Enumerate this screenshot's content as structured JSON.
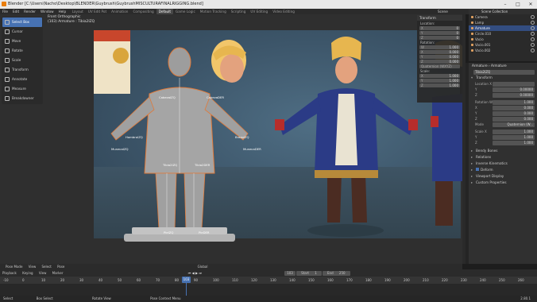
{
  "window": {
    "title": "Blender [C:\\Users\\Nacho\\Desktop\\BLENDER\\Guybrush\\GuybrushMISCULTURAFINALRIGGING.blend]"
  },
  "menu": {
    "items": [
      "File",
      "Edit",
      "Render",
      "Window",
      "Help"
    ],
    "workspaces": [
      "Layout",
      "UV Edit Pot",
      "Animation",
      "Compositing",
      "Default",
      "Game Logic",
      "Motion Tracking",
      "Scripting",
      "UV Editing",
      "Video Editing"
    ],
    "active_workspace": "Default",
    "scene": "Scene",
    "render_layer": "RenderLayer"
  },
  "viewport": {
    "view_name": "Front Orthographic",
    "object_info": "(103) Armature : Tibia2IZQ",
    "mode": "Pose Mode",
    "header_menus": [
      "View",
      "Select",
      "Pose"
    ],
    "orientation": "Global"
  },
  "tools": [
    {
      "label": "Select Box",
      "icon": "select-box-icon",
      "active": true
    },
    {
      "label": "Cursor",
      "icon": "cursor-icon",
      "active": false
    },
    {
      "label": "Move",
      "icon": "move-icon",
      "active": false
    },
    {
      "label": "Rotate",
      "icon": "rotate-icon",
      "active": false
    },
    {
      "label": "Scale",
      "icon": "scale-icon",
      "active": false
    },
    {
      "label": "Transform",
      "icon": "transform-icon",
      "active": false
    },
    {
      "label": "Annotate",
      "icon": "annotate-icon",
      "active": false
    },
    {
      "label": "Measure",
      "icon": "measure-icon",
      "active": false
    },
    {
      "label": "Breakdowner",
      "icon": "breakdowner-icon",
      "active": false
    }
  ],
  "bone_labels": [
    "CabezaIZQ",
    "CabezaDER",
    "HombroIZQ",
    "BrazoIZQ",
    "Tibia2IZQ",
    "Tibia2DER",
    "MunecaIZQ",
    "MunecaDER",
    "PieIZQ",
    "PieDER"
  ],
  "npanel": {
    "title": "Transform",
    "location_label": "Location:",
    "location": [
      {
        "k": "X",
        "v": "0"
      },
      {
        "k": "Y",
        "v": "0"
      },
      {
        "k": "Z",
        "v": "0"
      }
    ],
    "rotation_label": "Rotation:",
    "rotation": [
      {
        "k": "W",
        "v": "1.000"
      },
      {
        "k": "X",
        "v": "0.000"
      },
      {
        "k": "Y",
        "v": "0.000"
      },
      {
        "k": "Z",
        "v": "0.000"
      }
    ],
    "rotation_mode": "Quaternion (WXYZ)",
    "scale_label": "Scale:",
    "scale": [
      {
        "k": "X",
        "v": "1.000"
      },
      {
        "k": "Y",
        "v": "1.000"
      },
      {
        "k": "Z",
        "v": "1.000"
      }
    ]
  },
  "outliner": {
    "header": "Scene Collection",
    "items": [
      {
        "label": "Camera",
        "selected": false
      },
      {
        "label": "Lamp",
        "selected": false
      },
      {
        "label": "Armature",
        "selected": true
      },
      {
        "label": "Circle.010",
        "selected": false
      },
      {
        "label": "Vacio",
        "selected": false
      },
      {
        "label": "Vacio.001",
        "selected": false
      },
      {
        "label": "Vacio.002",
        "selected": false
      }
    ]
  },
  "properties": {
    "breadcrumb_a": "Armature",
    "breadcrumb_b": "Armature",
    "bone_name": "Tibia2IZQ",
    "transform_header": "Transform",
    "location_label": "Location X",
    "loc": [
      {
        "k": "Y",
        "v": "0.00000"
      },
      {
        "k": "Z",
        "v": "0.00000"
      }
    ],
    "rotation_label": "Rotation W",
    "rot": [
      {
        "k": "W",
        "v": "1.000"
      },
      {
        "k": "X",
        "v": "0.000"
      },
      {
        "k": "Y",
        "v": "0.000"
      },
      {
        "k": "Z",
        "v": "0.000"
      }
    ],
    "mode_label": "Mode",
    "mode_value": "Quaternion (W...",
    "scale": [
      {
        "k": "Scale X",
        "v": "1.000"
      },
      {
        "k": "Y",
        "v": "1.000"
      },
      {
        "k": "Z",
        "v": "1.000"
      }
    ],
    "sections": [
      "Bendy Bones",
      "Relations",
      "Inverse Kinematics",
      "Deform",
      "Viewport Display",
      "Custom Properties"
    ],
    "deform_checked": true
  },
  "timeline": {
    "menus": [
      "Playback",
      "Keying",
      "View",
      "Marker"
    ],
    "current_frame": "103",
    "start_label": "Start",
    "start": "1",
    "end_label": "End",
    "end": "250",
    "ticks": [
      "-10",
      "0",
      "10",
      "20",
      "30",
      "40",
      "50",
      "60",
      "70",
      "80",
      "90",
      "100",
      "110",
      "120",
      "130",
      "140",
      "150",
      "160",
      "170",
      "180",
      "190",
      "200",
      "210",
      "220",
      "230",
      "240",
      "250",
      "260"
    ]
  },
  "status": {
    "left": "Select",
    "mid1": "Box Select",
    "mid2": "Rotate View",
    "mid3": "Pose Context Menu",
    "version": "2.80.1"
  },
  "colors": {
    "accent": "#4772b3",
    "brand": "#e87d0d"
  }
}
